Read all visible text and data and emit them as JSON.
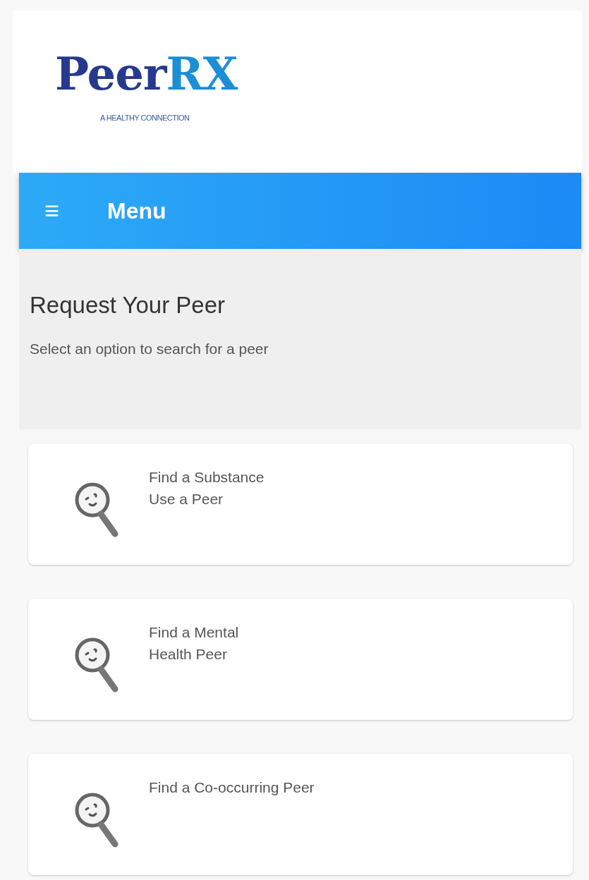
{
  "logo": {
    "parts": [
      "Peer",
      "RX"
    ],
    "tagline": "A HEALTHY CONNECTION"
  },
  "navbar": {
    "menu_icon": "≡",
    "title": "Menu"
  },
  "intro": {
    "heading": "Request Your Peer",
    "subtitle": "Select an option to search for a peer"
  },
  "options": [
    {
      "lines": [
        "Find a Substance",
        "Use a Peer"
      ]
    },
    {
      "lines": [
        "Find a Mental",
        "Health Peer"
      ]
    },
    {
      "lines": [
        "Find a Co-occurring Peer"
      ]
    }
  ]
}
